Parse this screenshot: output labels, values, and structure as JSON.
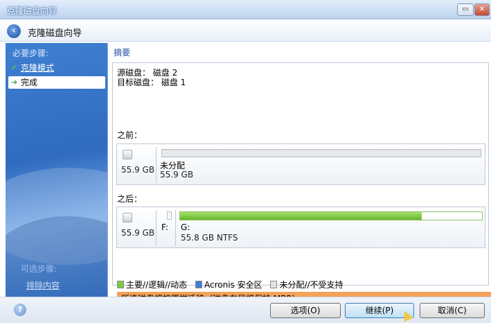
{
  "window": {
    "title": "克隆磁盘向导"
  },
  "header": {
    "title": "克隆磁盘向导"
  },
  "sidebar": {
    "heading": "必要步骤:",
    "items": [
      {
        "label": "克隆模式",
        "state": "done"
      },
      {
        "label": "完成",
        "state": "current"
      }
    ],
    "optional_heading": "可选步骤:",
    "optional_items": [
      {
        "label": "排除内容"
      }
    ]
  },
  "main": {
    "section_title": "摘要",
    "source_line": "源磁盘： 磁盘 2",
    "target_line": "目标磁盘： 磁盘 1",
    "before": {
      "label": "之前：",
      "disk_size": "55.9 GB",
      "partition_name": "未分配",
      "partition_size": "55.9 GB"
    },
    "after": {
      "label": "之后：",
      "disk_size": "55.9 GB",
      "drive_letter": "F:",
      "partition_name": "G:",
      "partition_size": "55.8 GB  NTFS",
      "used_fraction": 0.8
    },
    "legend": [
      {
        "label": "主要//逻辑//动态",
        "color": "#7cc943"
      },
      {
        "label": "Acronis 安全区",
        "color": "#3f7ed8"
      },
      {
        "label": "未分配//不受支持",
        "color": "#e2e4e6"
      }
    ],
    "status_message": "所选磁盘将按原样迁移（磁盘布局将保持 MBR）。"
  },
  "footer": {
    "options_label": "选项(O)",
    "next_label": "继续(P)",
    "cancel_label": "取消(C)"
  },
  "colors": {
    "status_bar": "#f3a25a",
    "sidebar": "#2f6bc0",
    "section_title": "#1f4f9e"
  }
}
